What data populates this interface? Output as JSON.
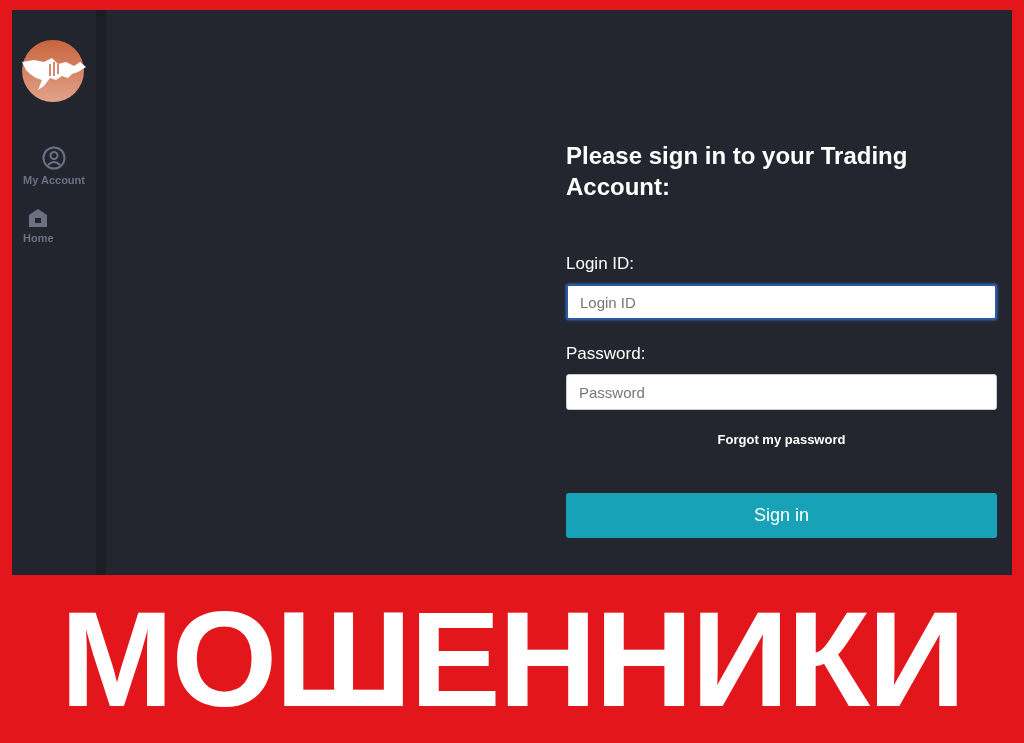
{
  "sidebar": {
    "items": [
      {
        "kind": "account",
        "label": "My Account"
      },
      {
        "kind": "home",
        "label": "Home"
      }
    ]
  },
  "login_form": {
    "title": "Please sign in to your Trading Account:",
    "fields": [
      {
        "label": "Login ID:",
        "placeholder": "Login ID",
        "focused": true
      },
      {
        "label": "Password:",
        "placeholder": "Password",
        "focused": false
      }
    ],
    "forgot_link": "Forgot my password",
    "submit_button": "Sign in"
  },
  "banner": {
    "text": "МОШЕННИКИ"
  }
}
